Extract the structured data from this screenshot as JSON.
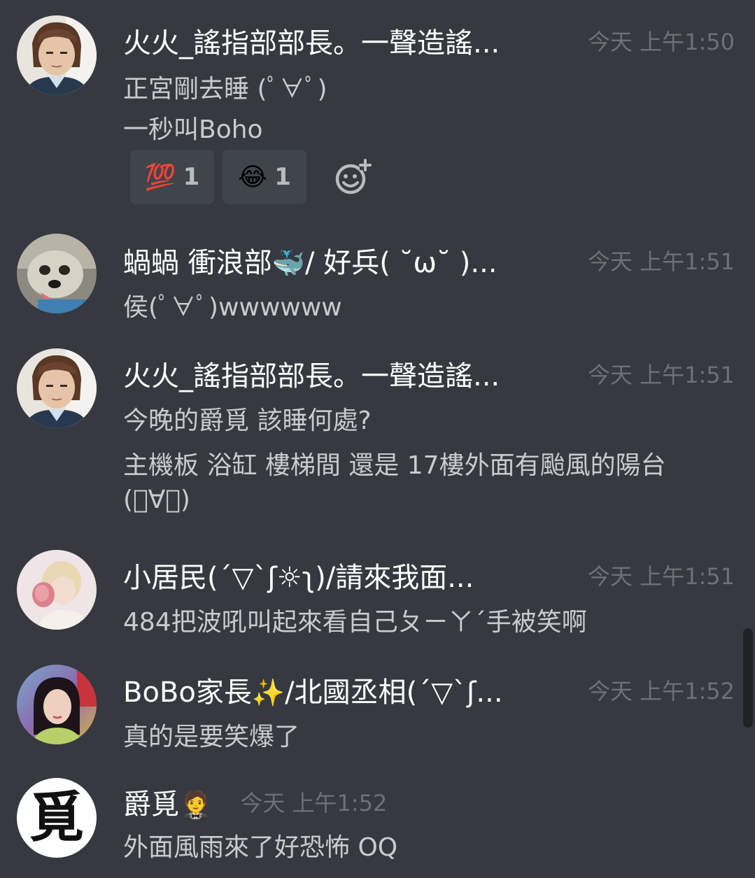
{
  "messages": [
    {
      "author": "火火_謠指部部長。一聲造謠...",
      "timestamp": "今天 上午1:50",
      "lines": [
        "正宮剛去睡 (ﾟ∀ﾟ)",
        "一秒叫Boho"
      ],
      "reactions": [
        {
          "emoji": "💯",
          "count": "1"
        },
        {
          "emoji": "😂",
          "count": "1"
        }
      ]
    },
    {
      "author_prefix": "蝸蝸 衝浪部",
      "author_emoji": "🐳",
      "author_suffix": "/ 好兵( ˘ω˘ )...",
      "timestamp": "今天 上午1:51",
      "lines": [
        "侯(ﾟ∀ﾟ)wwwwww"
      ]
    },
    {
      "author": "火火_謠指部部長。一聲造謠...",
      "timestamp": "今天 上午1:51",
      "lines": [
        "今晚的爵覓 該睡何處?",
        "主機板 浴缸 樓梯間 還是 17樓外面有颱風的陽台",
        "(ﾟ∀ﾟ)"
      ]
    },
    {
      "author": "小居民(´▽`ʃ☼ʅ)/請來我面...",
      "timestamp": "今天 上午1:51",
      "lines": [
        "484把波吼叫起來看自己ㄆㄧㄚˊ手被笑啊"
      ]
    },
    {
      "author_prefix": "BoBo家長",
      "author_emoji": "✨",
      "author_suffix": "/北國丞相(´▽`ʃ...",
      "timestamp": "今天 上午1:52",
      "lines": [
        "真的是要笑爆了"
      ]
    },
    {
      "author_prefix": "爵覓",
      "author_emoji": "🤵",
      "timestamp": "今天 上午1:52",
      "lines": [
        "外面風雨來了好恐怖 OQ"
      ],
      "avatar_char": "覓"
    }
  ],
  "colors": {
    "background": "#36393f",
    "author": "#ffffff",
    "timestamp": "#6d7076",
    "text": "#c9cbcf",
    "reaction_bg": "#40444b"
  }
}
